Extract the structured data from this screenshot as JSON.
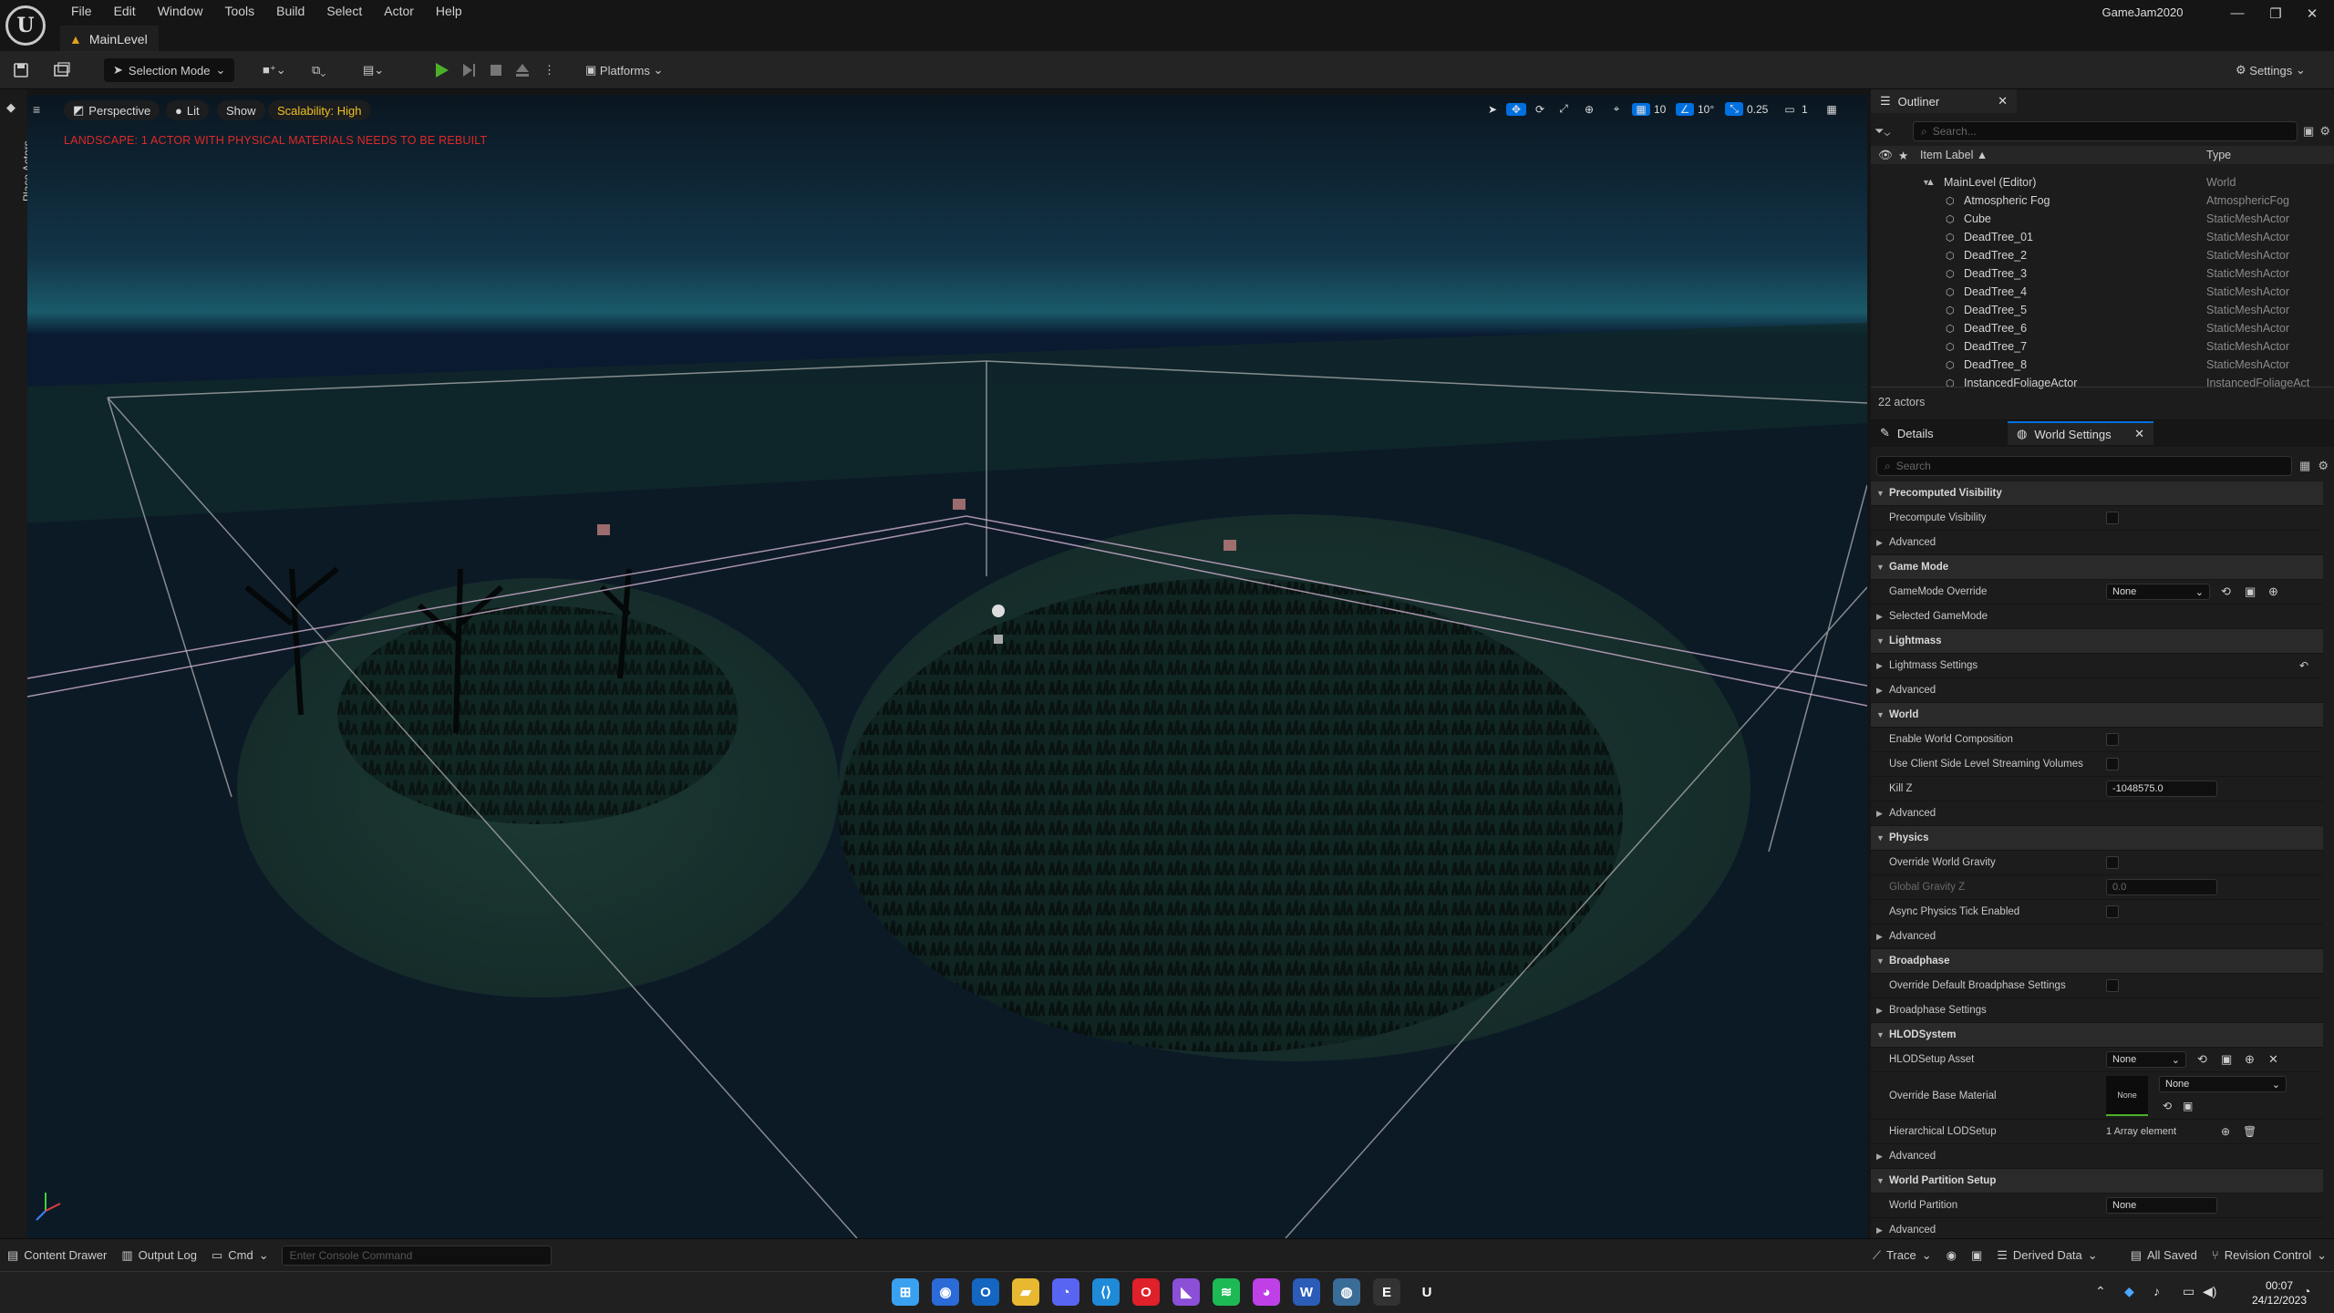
{
  "menu": [
    "File",
    "Edit",
    "Window",
    "Tools",
    "Build",
    "Select",
    "Actor",
    "Help"
  ],
  "level_tab": "MainLevel",
  "project_name": "GameJam2020",
  "window_controls": {
    "minimize": "—",
    "restore": "❐",
    "close": "✕"
  },
  "toolbar": {
    "selection_mode": "Selection Mode",
    "platforms": "Platforms",
    "settings": "Settings"
  },
  "left_strip": {
    "place_actors": "Place Actors"
  },
  "viewport": {
    "perspective": "Perspective",
    "lit": "Lit",
    "show": "Show",
    "scalability": "Scalability: High",
    "warning": "LANDSCAPE: 1 ACTOR WITH PHYSICAL MATERIALS NEEDS TO BE REBUILT",
    "grid_snap": "10",
    "rotation_snap": "10°",
    "scale_snap": "0.25",
    "camera_speed": "1"
  },
  "outliner": {
    "title": "Outliner",
    "search_placeholder": "Search...",
    "col_label": "Item Label ▲",
    "col_type": "Type",
    "rows": [
      {
        "label": "MainLevel (Editor)",
        "type": "World"
      },
      {
        "label": "Atmospheric Fog",
        "type": "AtmosphericFog"
      },
      {
        "label": "Cube",
        "type": "StaticMeshActor"
      },
      {
        "label": "DeadTree_01",
        "type": "StaticMeshActor"
      },
      {
        "label": "DeadTree_2",
        "type": "StaticMeshActor"
      },
      {
        "label": "DeadTree_3",
        "type": "StaticMeshActor"
      },
      {
        "label": "DeadTree_4",
        "type": "StaticMeshActor"
      },
      {
        "label": "DeadTree_5",
        "type": "StaticMeshActor"
      },
      {
        "label": "DeadTree_6",
        "type": "StaticMeshActor"
      },
      {
        "label": "DeadTree_7",
        "type": "StaticMeshActor"
      },
      {
        "label": "DeadTree_8",
        "type": "StaticMeshActor"
      },
      {
        "label": "InstancedFoliageActor",
        "type": "InstancedFoliageAct"
      }
    ],
    "actor_count": "22 actors"
  },
  "details": {
    "tab_details": "Details",
    "tab_world_settings": "World Settings",
    "search_placeholder": "Search",
    "rows": [
      {
        "kind": "cat",
        "label": "Precomputed Visibility"
      },
      {
        "kind": "check",
        "label": "Precompute Visibility"
      },
      {
        "kind": "sub",
        "label": "Advanced"
      },
      {
        "kind": "cat",
        "label": "Game Mode"
      },
      {
        "kind": "dropdown",
        "label": "GameMode Override",
        "value": "None"
      },
      {
        "kind": "sub",
        "label": "Selected GameMode"
      },
      {
        "kind": "cat",
        "label": "Lightmass"
      },
      {
        "kind": "sub",
        "label": "Lightmass Settings"
      },
      {
        "kind": "sub",
        "label": "Advanced"
      },
      {
        "kind": "cat",
        "label": "World"
      },
      {
        "kind": "check",
        "label": "Enable World Composition"
      },
      {
        "kind": "check",
        "label": "Use Client Side Level Streaming Volumes"
      },
      {
        "kind": "field",
        "label": "Kill Z",
        "value": "-1048575.0"
      },
      {
        "kind": "sub",
        "label": "Advanced"
      },
      {
        "kind": "cat",
        "label": "Physics"
      },
      {
        "kind": "check",
        "label": "Override World Gravity"
      },
      {
        "kind": "field",
        "label": "Global Gravity Z",
        "value": "0.0",
        "dim": true
      },
      {
        "kind": "check",
        "label": "Async Physics Tick Enabled"
      },
      {
        "kind": "sub",
        "label": "Advanced"
      },
      {
        "kind": "cat",
        "label": "Broadphase"
      },
      {
        "kind": "check",
        "label": "Override Default Broadphase Settings"
      },
      {
        "kind": "sub",
        "label": "Broadphase Settings"
      },
      {
        "kind": "cat",
        "label": "HLODSystem"
      },
      {
        "kind": "dropdown",
        "label": "HLODSetup Asset",
        "value": "None"
      },
      {
        "kind": "material",
        "label": "Override Base Material",
        "value": "None",
        "thumb": "None"
      },
      {
        "kind": "array",
        "label": "Hierarchical LODSetup",
        "value": "1 Array element"
      },
      {
        "kind": "sub",
        "label": "Advanced"
      },
      {
        "kind": "cat",
        "label": "World Partition Setup"
      },
      {
        "kind": "field",
        "label": "World Partition",
        "value": "None"
      },
      {
        "kind": "sub",
        "label": "Advanced"
      }
    ]
  },
  "statusbar": {
    "content_drawer": "Content Drawer",
    "output_log": "Output Log",
    "cmd": "Cmd",
    "console_placeholder": "Enter Console Command",
    "trace": "Trace",
    "derived_data": "Derived Data",
    "all_saved": "All Saved",
    "revision_control": "Revision Control"
  },
  "taskbar": {
    "time": "00:07",
    "date": "24/12/2023",
    "apps": [
      {
        "name": "start-menu-icon",
        "glyph": "⊞",
        "color": "#3aa0f0"
      },
      {
        "name": "app-icon-1",
        "glyph": "◉",
        "color": "#2a6bd8"
      },
      {
        "name": "outlook-icon",
        "glyph": "O",
        "color": "#1466c0"
      },
      {
        "name": "file-explorer-icon",
        "glyph": "▰",
        "color": "#e8b830"
      },
      {
        "name": "discord-icon",
        "glyph": "◔",
        "color": "#5865f2"
      },
      {
        "name": "vscode-icon",
        "glyph": "⟨⟩",
        "color": "#1f8ad8"
      },
      {
        "name": "opera-icon",
        "glyph": "O",
        "color": "#e0202a"
      },
      {
        "name": "visual-studio-icon",
        "glyph": "◣",
        "color": "#8b4fd8"
      },
      {
        "name": "spotify-icon",
        "glyph": "≋",
        "color": "#1db954"
      },
      {
        "name": "messenger-icon",
        "glyph": "◕",
        "color": "#c040e8"
      },
      {
        "name": "word-icon",
        "glyph": "W",
        "color": "#2b5cb8"
      },
      {
        "name": "steam-icon",
        "glyph": "◍",
        "color": "#3a6c98"
      },
      {
        "name": "epic-games-icon",
        "glyph": "E",
        "color": "#333333"
      },
      {
        "name": "unreal-engine-icon",
        "glyph": "U",
        "color": "#202020"
      }
    ]
  },
  "colors": {
    "accent": "#0070e0",
    "play_green": "#4caf2a",
    "warning_red": "#e02828",
    "scalability_yellow": "#f0c020"
  }
}
